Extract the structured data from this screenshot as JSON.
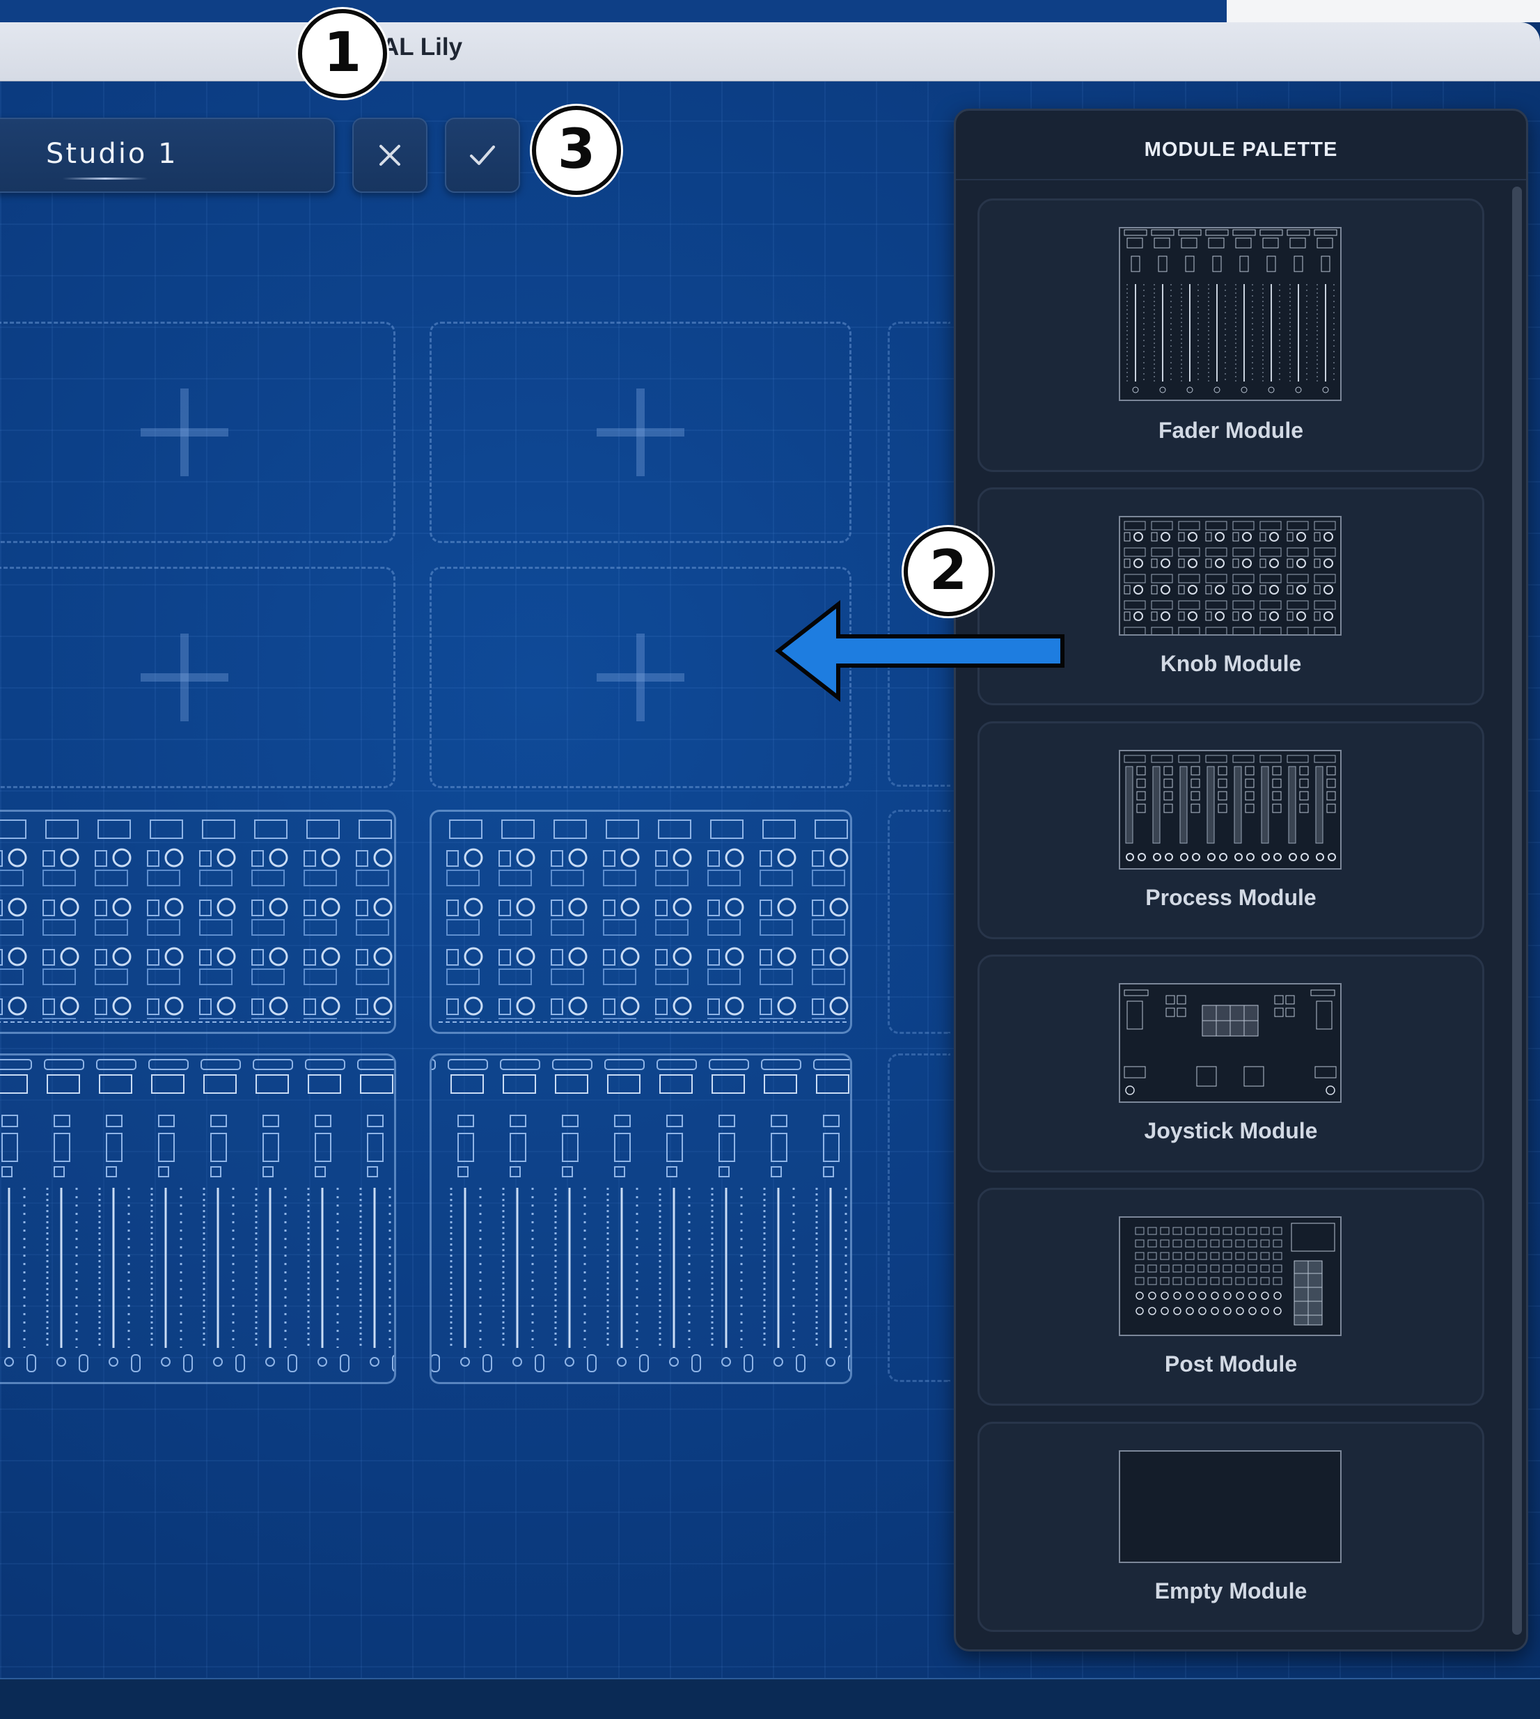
{
  "window": {
    "title": "AL Lily"
  },
  "toolbar": {
    "studio_name": "Studio 1",
    "cancel_icon": "close-icon",
    "confirm_icon": "check-icon"
  },
  "palette": {
    "title": "MODULE PALETTE",
    "items": [
      {
        "label": "Fader Module",
        "icon": "fader-module-thumbnail"
      },
      {
        "label": "Knob Module",
        "icon": "knob-module-thumbnail"
      },
      {
        "label": "Process Module",
        "icon": "process-module-thumbnail"
      },
      {
        "label": "Joystick Module",
        "icon": "joystick-module-thumbnail"
      },
      {
        "label": "Post Module",
        "icon": "post-module-thumbnail"
      },
      {
        "label": "Empty Module",
        "icon": "empty-module-thumbnail"
      }
    ]
  },
  "annotations": {
    "callout_1": "1",
    "callout_2": "2",
    "callout_3": "3"
  },
  "colors": {
    "canvas_background": "#0b3b80",
    "palette_background": "#182334",
    "arrow": "#1e7de0"
  }
}
